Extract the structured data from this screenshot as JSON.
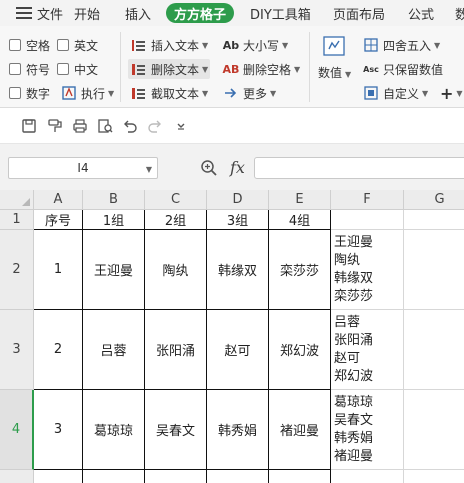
{
  "menu": {
    "items": [
      "文件",
      "开始",
      "插入",
      "方方格子",
      "DIY工具箱",
      "页面布局",
      "公式",
      "数"
    ],
    "active_index": 3
  },
  "ribbon": {
    "checkboxes": [
      "空格",
      "英文",
      "符号",
      "中文",
      "数字"
    ],
    "exec_label": "执行",
    "text_tools": [
      "插入文本",
      "删除文本",
      "截取文本"
    ],
    "case_tools": [
      "大小写",
      "删除空格",
      "更多"
    ],
    "case_icons": [
      "Ab",
      "AB"
    ],
    "number_label": "数值",
    "rounding_label": "四舍五入",
    "keep_numbers_label": "只保留数值",
    "keep_numbers_icon": "Asc",
    "custom_label": "自定义",
    "plus_label": "+"
  },
  "formula_bar": {
    "cell_ref": "I4",
    "fx_label": "fx",
    "formula": ""
  },
  "sheet": {
    "columns": [
      "A",
      "B",
      "C",
      "D",
      "E",
      "F",
      "G"
    ],
    "row_headers": [
      "1",
      "2",
      "3",
      "4"
    ],
    "selected_row": "4",
    "header_row": [
      "序号",
      "1组",
      "2组",
      "3组",
      "4组",
      ""
    ],
    "rows": [
      {
        "cells": [
          "1",
          "王迎曼",
          "陶纨",
          "韩缘双",
          "栾莎莎"
        ],
        "f_lines": [
          "王迎曼",
          "陶纨",
          "韩缘双",
          "栾莎莎"
        ]
      },
      {
        "cells": [
          "2",
          "吕蓉",
          "张阳涌",
          "赵可",
          "郑幻波"
        ],
        "f_lines": [
          "吕蓉",
          "张阳涌",
          "赵可",
          "郑幻波"
        ]
      },
      {
        "cells": [
          "3",
          "葛琼琼",
          "吴春文",
          "韩秀娟",
          "褚迎曼"
        ],
        "f_lines": [
          "葛琼琼",
          "吴春文",
          "韩秀娟",
          "褚迎曼"
        ]
      }
    ]
  },
  "colors": {
    "accent": "#2d9c4b",
    "menubar_bg": "#f3f3f3",
    "header_bg": "#ececec"
  }
}
